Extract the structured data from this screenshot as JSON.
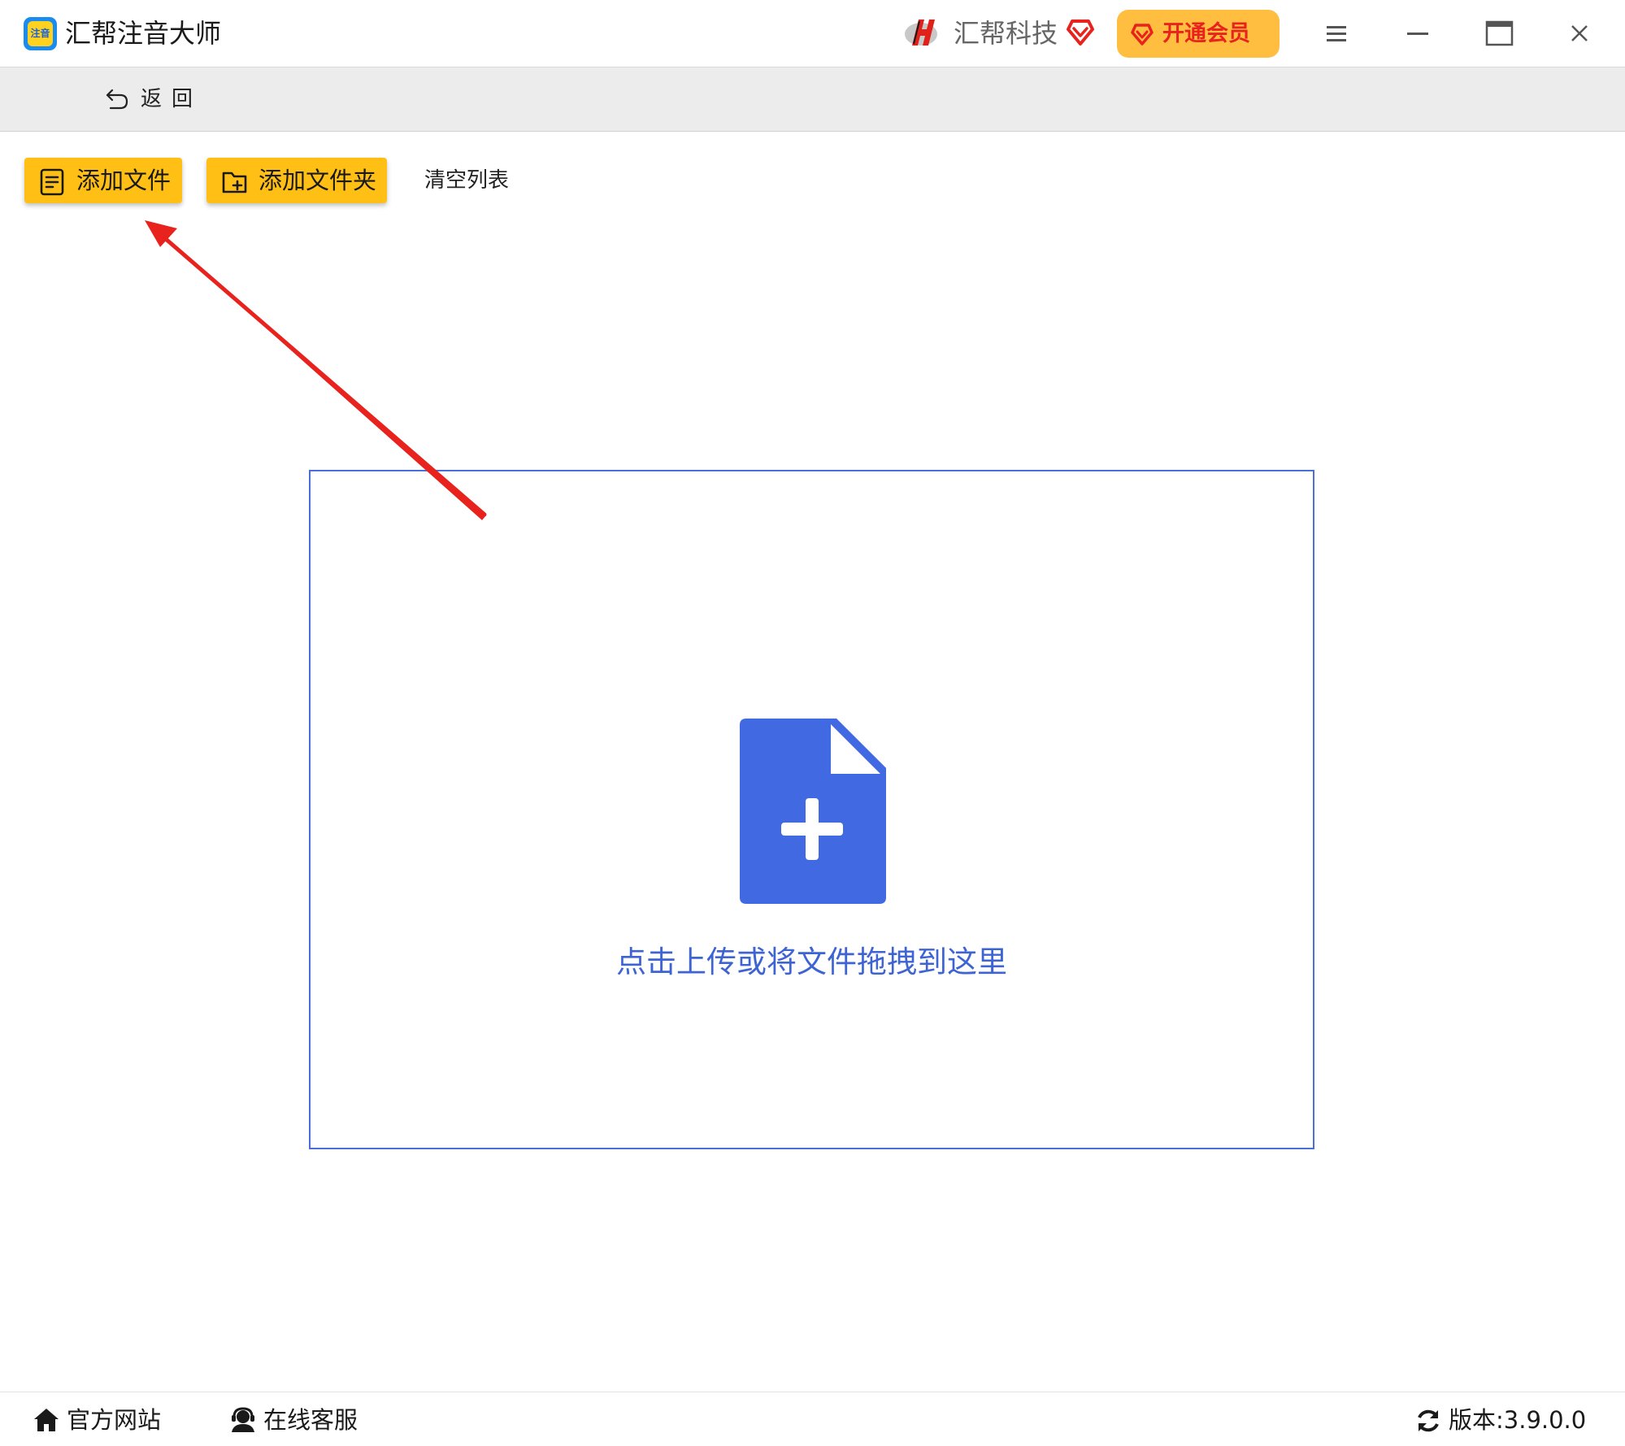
{
  "titlebar": {
    "app_logo_text": "注音",
    "app_title": "汇帮注音大师",
    "brand_name": "汇帮科技",
    "vip_button_label": "开通会员"
  },
  "backbar": {
    "back_label": "返回"
  },
  "toolbar": {
    "add_file_label": "添加文件",
    "add_folder_label": "添加文件夹",
    "clear_list_label": "清空列表"
  },
  "dropzone": {
    "prompt": "点击上传或将文件拖拽到这里"
  },
  "statusbar": {
    "website_label": "官方网站",
    "support_label": "在线客服",
    "version_label": "版本:3.9.0.0"
  },
  "colors": {
    "accent_yellow": "#ffbf14",
    "vip_orange": "#ffbe3f",
    "vip_red": "#e8231e",
    "drop_blue": "#3e63d3",
    "icon_blue": "#4169e1",
    "annotation_red": "#e8231e"
  },
  "icons": {
    "app_logo": "app-logo-icon",
    "brand_logo": "huibang-logo-icon",
    "vip_heart": "diamond-heart-icon",
    "menu": "hamburger-menu-icon",
    "minimize": "minimize-icon",
    "maximize": "maximize-icon",
    "close": "close-icon",
    "back": "back-arrow-icon",
    "add_file": "file-list-icon",
    "add_folder": "folder-add-icon",
    "upload": "file-plus-icon",
    "website": "home-icon",
    "support": "headset-user-icon",
    "version": "refresh-icon",
    "annotation": "red-arrow"
  }
}
